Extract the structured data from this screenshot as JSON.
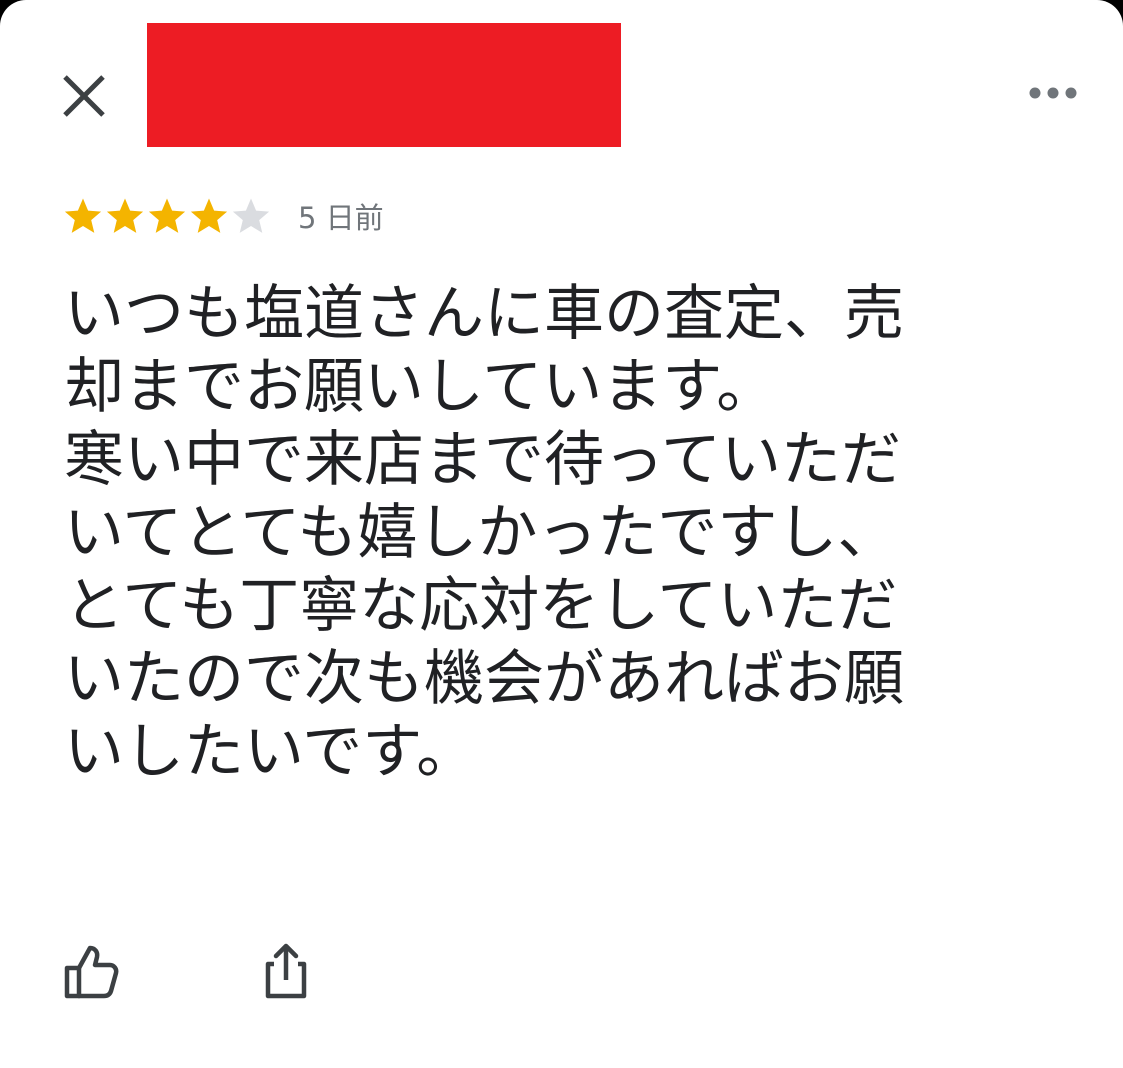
{
  "header": {
    "close_icon": "close-icon",
    "more_icon": "more-horizontal-icon",
    "redaction_color": "#ED1C24"
  },
  "review": {
    "rating": 4,
    "rating_max": 5,
    "star_color": "#F4B400",
    "star_empty_color": "#DADCE0",
    "date": "5 日前",
    "lines": [
      "いつも塩道さんに車の査定、売",
      "却までお願いしています。",
      "寒い中で来店まで待っていただ",
      "いてとても嬉しかったですし、",
      "とても丁寧な応対をしていただ",
      "いたので次も機会があればお願",
      "いしたいです。"
    ]
  },
  "actions": {
    "like_icon": "thumbs-up-icon",
    "share_icon": "share-icon"
  }
}
